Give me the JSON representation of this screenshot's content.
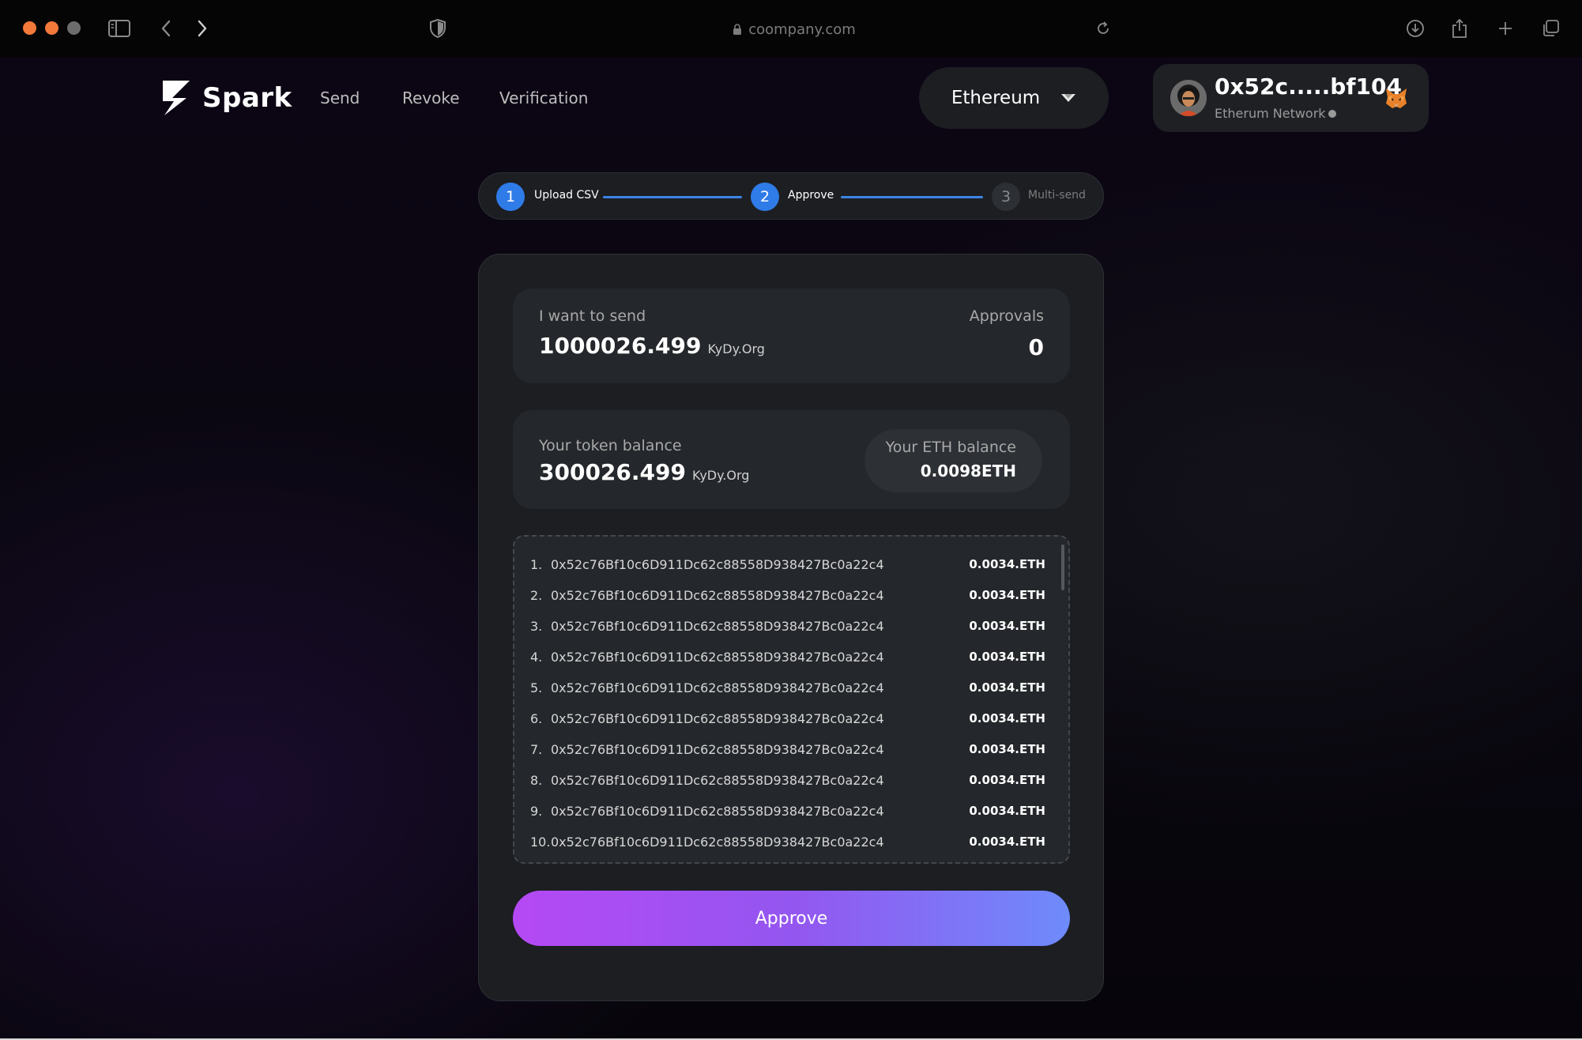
{
  "browser": {
    "url": "coompany.com"
  },
  "nav": {
    "brand": "Spark",
    "links": [
      "Send",
      "Revoke",
      "Verification"
    ],
    "network": "Ethereum"
  },
  "wallet": {
    "address": "0x52c.....bf104",
    "network": "Etherum Network"
  },
  "stepper": {
    "steps": [
      {
        "num": "1",
        "label": "Upload CSV"
      },
      {
        "num": "2",
        "label": "Approve"
      },
      {
        "num": "3",
        "label": "Multi-send"
      }
    ]
  },
  "send": {
    "label": "I want to send",
    "amount": "1000026.499",
    "unit": "KyDy.Org",
    "approvals_label": "Approvals",
    "approvals_value": "0"
  },
  "balance": {
    "token_label": "Your token balance",
    "token_amount": "300026.499",
    "token_unit": "KyDy.Org",
    "eth_label": "Your ETH balance",
    "eth_amount": "0.0098ETH"
  },
  "recipients": [
    {
      "num": "1.",
      "address": "0x52c76Bf10c6D911Dc62c88558D938427Bc0a22c4",
      "amount": "0.0034.ETH"
    },
    {
      "num": "2.",
      "address": "0x52c76Bf10c6D911Dc62c88558D938427Bc0a22c4",
      "amount": "0.0034.ETH"
    },
    {
      "num": "3.",
      "address": "0x52c76Bf10c6D911Dc62c88558D938427Bc0a22c4",
      "amount": "0.0034.ETH"
    },
    {
      "num": "4.",
      "address": "0x52c76Bf10c6D911Dc62c88558D938427Bc0a22c4",
      "amount": "0.0034.ETH"
    },
    {
      "num": "5.",
      "address": "0x52c76Bf10c6D911Dc62c88558D938427Bc0a22c4",
      "amount": "0.0034.ETH"
    },
    {
      "num": "6.",
      "address": "0x52c76Bf10c6D911Dc62c88558D938427Bc0a22c4",
      "amount": "0.0034.ETH"
    },
    {
      "num": "7.",
      "address": "0x52c76Bf10c6D911Dc62c88558D938427Bc0a22c4",
      "amount": "0.0034.ETH"
    },
    {
      "num": "8.",
      "address": "0x52c76Bf10c6D911Dc62c88558D938427Bc0a22c4",
      "amount": "0.0034.ETH"
    },
    {
      "num": "9.",
      "address": "0x52c76Bf10c6D911Dc62c88558D938427Bc0a22c4",
      "amount": "0.0034.ETH"
    },
    {
      "num": "10.",
      "address": "0x52c76Bf10c6D911Dc62c88558D938427Bc0a22c4",
      "amount": "0.0034.ETH"
    }
  ],
  "actions": {
    "approve": "Approve"
  },
  "icons": {
    "sidebar": "sidebar-icon",
    "back": "chevron-left-icon",
    "forward": "chevron-right-icon",
    "shield": "shield-icon",
    "lock": "lock-icon",
    "reload": "reload-icon",
    "download": "download-icon",
    "share": "share-icon",
    "new_tab": "plus-icon",
    "tabs": "tabs-icon",
    "dropdown": "caret-down-icon",
    "metamask": "metamask-fox-icon"
  },
  "colors": {
    "accent_blue": "#2f7be8",
    "gradient_start": "#b549f4",
    "gradient_end": "#6e8bfb",
    "window_close": "#f2793a"
  }
}
